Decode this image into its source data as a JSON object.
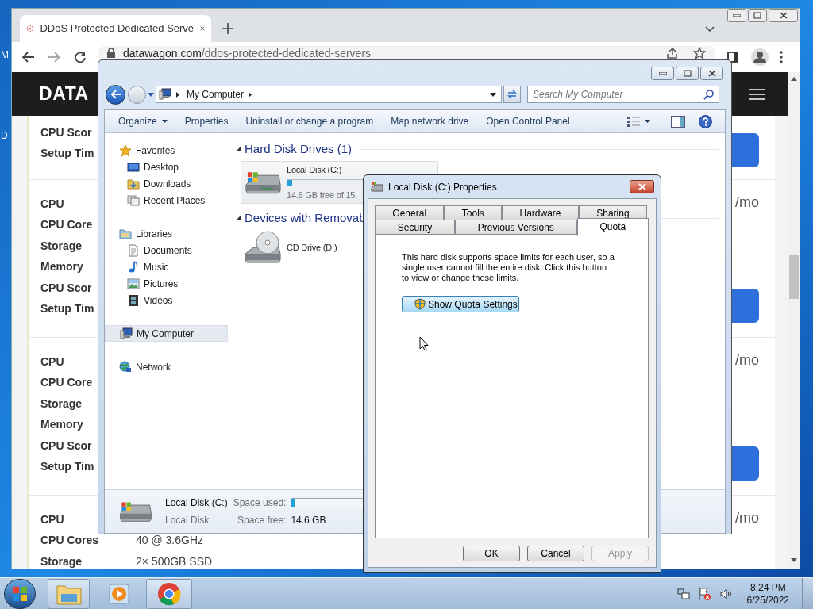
{
  "desktop": {
    "icon_labels": [
      "M",
      "D"
    ]
  },
  "browser": {
    "tabs": [
      {
        "title": "DDoS Protected Dedicated Serve",
        "selected": true
      }
    ],
    "url_host": "datawagon.com",
    "url_path": "/ddos-protected-dedicated-servers",
    "site": {
      "logo": "DATA",
      "blocks": [
        {
          "rows": [
            {
              "label": "CPU Scor"
            },
            {
              "label": "Setup Tim"
            }
          ],
          "button": true
        },
        {
          "rows": [
            {
              "label": "CPU"
            },
            {
              "label": "CPU Core"
            },
            {
              "label": "Storage"
            },
            {
              "label": "Memory"
            },
            {
              "label": "CPU Scor"
            },
            {
              "label": "Setup Tim"
            }
          ],
          "price": "/mo",
          "button": true
        },
        {
          "rows": [
            {
              "label": "CPU"
            },
            {
              "label": "CPU Core"
            },
            {
              "label": "Storage"
            },
            {
              "label": "Memory"
            },
            {
              "label": "CPU Scor"
            },
            {
              "label": "Setup Tim"
            }
          ],
          "price": "/mo",
          "button": true
        },
        {
          "rows": [
            {
              "label": "CPU"
            },
            {
              "label": "CPU Cores",
              "value": "40 @ 3.6GHz"
            },
            {
              "label": "Storage",
              "value": "2× 500GB SSD"
            }
          ],
          "price": "/mo",
          "button": false
        }
      ]
    }
  },
  "explorer": {
    "crumbs": [
      "My Computer"
    ],
    "search_placeholder": "Search My Computer",
    "toolbar": [
      {
        "label": "Organize",
        "menu": true
      },
      {
        "label": "Properties",
        "menu": false
      },
      {
        "label": "Uninstall or change a program",
        "menu": false
      },
      {
        "label": "Map network drive",
        "menu": false
      },
      {
        "label": "Open Control Panel",
        "menu": false
      }
    ],
    "nav": [
      {
        "label": "Favorites",
        "kind": "star",
        "selected": false,
        "children": [
          {
            "label": "Desktop",
            "kind": "desktop",
            "selected": false
          },
          {
            "label": "Downloads",
            "kind": "downloads",
            "selected": false
          },
          {
            "label": "Recent Places",
            "kind": "recent",
            "selected": false
          }
        ]
      },
      {
        "label": "Libraries",
        "kind": "library",
        "selected": false,
        "children": [
          {
            "label": "Documents",
            "kind": "documents",
            "selected": false
          },
          {
            "label": "Music",
            "kind": "music",
            "selected": false
          },
          {
            "label": "Pictures",
            "kind": "pictures",
            "selected": false
          },
          {
            "label": "Videos",
            "kind": "videos",
            "selected": false
          }
        ]
      },
      {
        "label": "My Computer",
        "kind": "computer",
        "selected": true
      },
      {
        "label": "Network",
        "kind": "network",
        "selected": false
      }
    ],
    "groups": [
      {
        "title": "Hard Disk Drives (1)",
        "expanded": true,
        "items": [
          {
            "kind": "hdd",
            "name": "Local Disk (C:)",
            "level": 0.03,
            "info": "14.6 GB free of 15.",
            "highlighted": true
          }
        ]
      },
      {
        "title": "Devices with Removab",
        "expanded": true,
        "items": [
          {
            "kind": "cd",
            "name": "CD Drive (D:)",
            "highlighted": false
          }
        ]
      }
    ],
    "details": {
      "name": "Local Disk (C:)",
      "type": "Local Disk",
      "used_label": "Space used:",
      "level": 0.03,
      "free_label": "Space free:",
      "free_value": "14.6 GB"
    }
  },
  "properties_dialog": {
    "title": "Local Disk (C:) Properties",
    "tab_rows": [
      [
        {
          "label": "General",
          "selected": false
        },
        {
          "label": "Tools",
          "selected": false
        },
        {
          "label": "Hardware",
          "selected": false
        },
        {
          "label": "Sharing",
          "selected": false
        }
      ],
      [
        {
          "label": "Security",
          "selected": false
        },
        {
          "label": "Previous Versions",
          "selected": false
        },
        {
          "label": "Quota",
          "selected": true
        }
      ]
    ],
    "message": "This hard disk supports space limits for each user, so a single user cannot fill the entire disk. Click this button to view or change these limits.",
    "action": "Show Quota Settings",
    "buttons": [
      {
        "label": "OK",
        "disabled": false
      },
      {
        "label": "Cancel",
        "disabled": false
      },
      {
        "label": "Apply",
        "disabled": true
      }
    ]
  },
  "taskbar": {
    "apps": [
      {
        "kind": "explorer",
        "running": true
      },
      {
        "kind": "media",
        "running": false
      },
      {
        "kind": "chrome",
        "running": true
      }
    ],
    "time": "8:24 PM",
    "date": "6/25/2022"
  }
}
